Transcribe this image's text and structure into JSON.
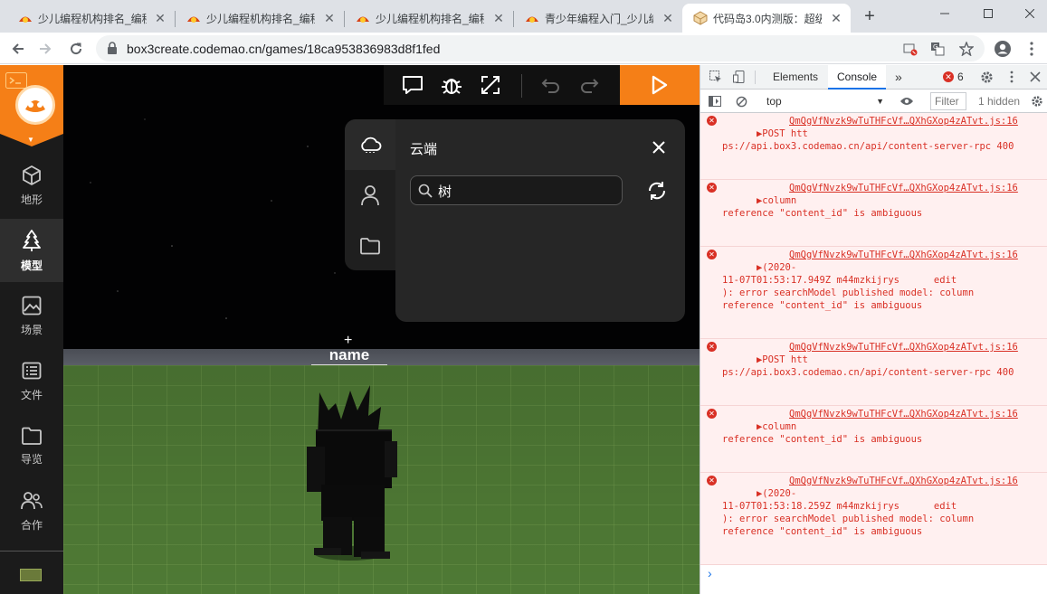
{
  "browser": {
    "tabs": [
      {
        "title": "少儿编程机构排名_编程",
        "active": false
      },
      {
        "title": "少儿编程机构排名_编程",
        "active": false
      },
      {
        "title": "少儿编程机构排名_编程",
        "active": false
      },
      {
        "title": "青少年编程入门_少儿编",
        "active": false
      },
      {
        "title": "代码岛3.0内测版：超级",
        "active": true
      }
    ],
    "url": "box3create.codemao.cn/games/18ca953836983d8f1fed"
  },
  "sidebar": {
    "items": [
      {
        "label": "地形",
        "icon": "cube-icon"
      },
      {
        "label": "模型",
        "icon": "tree-icon",
        "active": true
      },
      {
        "label": "场景",
        "icon": "image-icon"
      },
      {
        "label": "文件",
        "icon": "file-list-icon"
      },
      {
        "label": "导览",
        "icon": "folder-icon"
      },
      {
        "label": "合作",
        "icon": "users-icon"
      }
    ]
  },
  "viewport": {
    "name_tag": "name"
  },
  "cloud_panel": {
    "title": "云端",
    "search": {
      "value": "树"
    }
  },
  "devtools": {
    "tabs": [
      "Elements",
      "Console"
    ],
    "active_tab": "Console",
    "error_count": "6",
    "context": "top",
    "filter_placeholder": "Filter",
    "hidden": "1 hidden",
    "messages": [
      {
        "line1": "▶POST htt",
        "src": "QmQgVfNvzk9wTuTHFcVf…QXhGXop4zATvt.js:16",
        "line2": "ps://api.box3.codemao.cn/api/content-server-rpc 400"
      },
      {
        "line1": "▶column",
        "src": "QmQgVfNvzk9wTuTHFcVf…QXhGXop4zATvt.js:16",
        "line2": "reference \"content_id\" is ambiguous"
      },
      {
        "line1": "▶(2020-",
        "src": "QmQgVfNvzk9wTuTHFcVf…QXhGXop4zATvt.js:16",
        "line2": "11-07T01:53:17.949Z m44mzkijrys      edit",
        "line3": "): error searchModel published model: column",
        "line4": "reference \"content_id\" is ambiguous"
      },
      {
        "line1": "▶POST htt",
        "src": "QmQgVfNvzk9wTuTHFcVf…QXhGXop4zATvt.js:16",
        "line2": "ps://api.box3.codemao.cn/api/content-server-rpc 400"
      },
      {
        "line1": "▶column",
        "src": "QmQgVfNvzk9wTuTHFcVf…QXhGXop4zATvt.js:16",
        "line2": "reference \"content_id\" is ambiguous"
      },
      {
        "line1": "▶(2020-",
        "src": "QmQgVfNvzk9wTuTHFcVf…QXhGXop4zATvt.js:16",
        "line2": "11-07T01:53:18.259Z m44mzkijrys      edit",
        "line3": "): error searchModel published model: column",
        "line4": "reference \"content_id\" is ambiguous"
      }
    ],
    "prompt": "›"
  },
  "colors": {
    "accent": "#f57f17",
    "error": "#d93025",
    "devtools_blue": "#1a73e8"
  }
}
